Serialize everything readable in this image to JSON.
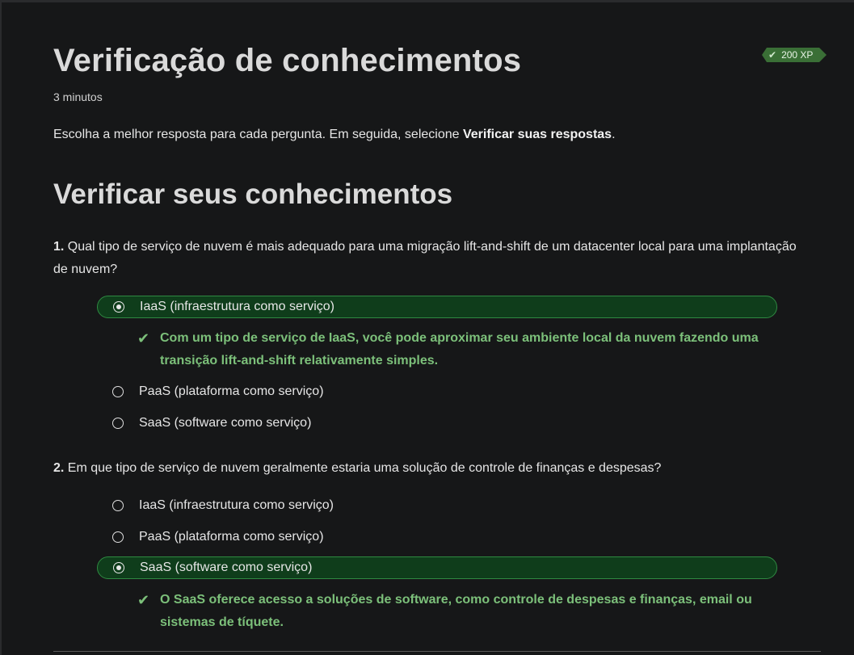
{
  "header": {
    "title": "Verificação de conhecimentos",
    "duration": "3 minutos",
    "xp": "200 XP"
  },
  "intro": {
    "text": "Escolha a melhor resposta para cada pergunta. Em seguida, selecione ",
    "emphasis": "Verificar suas respostas",
    "end": "."
  },
  "section_title": "Verificar seus conhecimentos",
  "questions": [
    {
      "number": "1.",
      "text": " Qual tipo de serviço de nuvem é mais adequado para uma migração lift-and-shift de um datacenter local para uma implantação de nuvem?",
      "options": [
        {
          "label": "IaaS (infraestrutura como serviço)",
          "selected": true
        },
        {
          "label": "PaaS (plataforma como serviço)",
          "selected": false
        },
        {
          "label": "SaaS (software como serviço)",
          "selected": false
        }
      ],
      "feedback": "Com um tipo de serviço de IaaS, você pode aproximar seu ambiente local da nuvem fazendo uma transição lift-and-shift relativamente simples."
    },
    {
      "number": "2.",
      "text": " Em que tipo de serviço de nuvem geralmente estaria uma solução de controle de finanças e despesas?",
      "options": [
        {
          "label": "IaaS (infraestrutura como serviço)",
          "selected": false
        },
        {
          "label": "PaaS (plataforma como serviço)",
          "selected": false
        },
        {
          "label": "SaaS (software como serviço)",
          "selected": true
        }
      ],
      "feedback": "O SaaS oferece acesso a soluções de software, como controle de despesas e finanças, email ou sistemas de tíquete."
    }
  ],
  "icons": {
    "check": "check-icon",
    "radio_selected": "radio-selected-icon",
    "radio_unselected": "radio-unselected-icon"
  },
  "colors": {
    "background": "#161718",
    "selected_fill": "#0f3d1b",
    "selected_border": "#2f8a42",
    "feedback_text": "#7cc07a",
    "xp_badge": "#3a6f36"
  }
}
